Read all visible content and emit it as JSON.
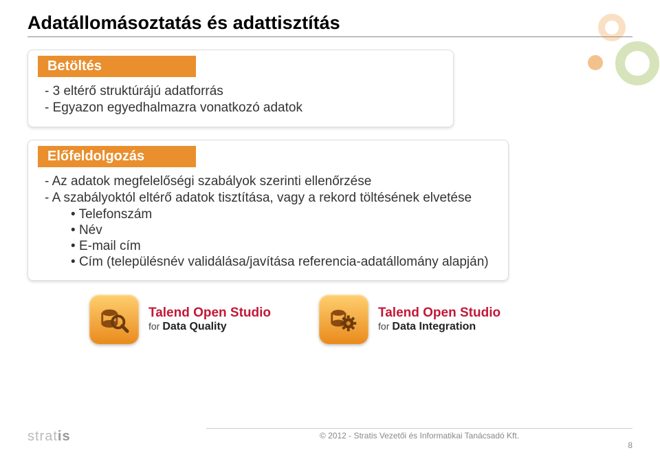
{
  "title": "Adatállomásoztatás és adattisztítás",
  "panels": [
    {
      "header": "Betöltés",
      "bullets": [
        "3 eltérő struktúrájú adatforrás",
        "Egyazon egyedhalmazra vonatkozó adatok"
      ]
    },
    {
      "header": "Előfeldolgozás",
      "bullets": [
        "Az adatok megfelelőségi szabályok szerinti ellenőrzése",
        "A szabályoktól eltérő adatok tisztítása, vagy a rekord töltésének elvetése"
      ],
      "sub": [
        "Telefonszám",
        "Név",
        "E-mail cím",
        "Cím (településnév validálása/javítása referencia-adatállomány alapján)"
      ]
    }
  ],
  "products": [
    {
      "line1": "Talend Open Studio",
      "for": "for",
      "name": "Data Quality",
      "icon": "magnify-db"
    },
    {
      "line1": "Talend Open Studio",
      "for": "for",
      "name": "Data Integration",
      "icon": "gear-db"
    }
  ],
  "footer": {
    "copyright": "© 2012 - Stratis Vezetői és Informatikai Tanácsadó Kft.",
    "page": "8",
    "logo_a": "strat",
    "logo_b": "is"
  }
}
